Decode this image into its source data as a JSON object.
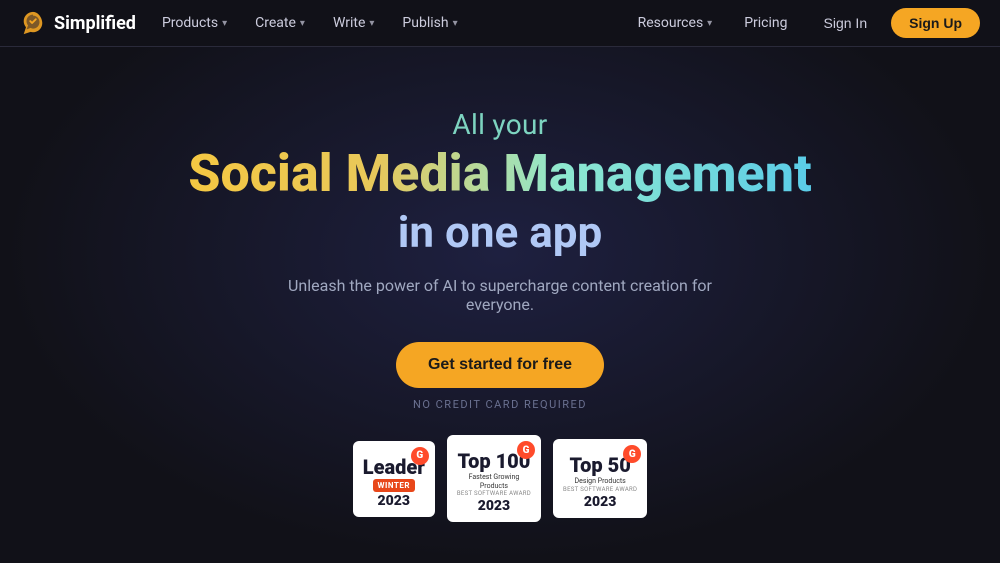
{
  "navbar": {
    "logo_text": "Simplified",
    "nav_items": [
      {
        "label": "Products",
        "has_dropdown": true
      },
      {
        "label": "Create",
        "has_dropdown": true
      },
      {
        "label": "Write",
        "has_dropdown": true
      },
      {
        "label": "Publish",
        "has_dropdown": true
      },
      {
        "label": "Resources",
        "has_dropdown": true
      },
      {
        "label": "Pricing",
        "has_dropdown": false
      }
    ],
    "sign_in_label": "Sign In",
    "sign_up_label": "Sign Up"
  },
  "hero": {
    "subtitle": "All your",
    "title_main": "Social Media Management",
    "title_bottom": "in one app",
    "description": "Unleash the power of AI to supercharge content creation for everyone.",
    "cta_button": "Get started for free",
    "no_credit_text": "NO CREDIT CARD REQUIRED"
  },
  "badges": [
    {
      "rank": "Leader",
      "type_label": "WINTER",
      "year": "2023",
      "g_label": "G",
      "desc": ""
    },
    {
      "rank": "Top 100",
      "type_label": "Fastest Growing Products",
      "year": "2023",
      "g_label": "G",
      "desc": "BEST SOFTWARE AWARD"
    },
    {
      "rank": "Top 50",
      "type_label": "Design Products",
      "year": "2023",
      "g_label": "G",
      "desc": "BEST SOFTWARE AWARD"
    }
  ],
  "colors": {
    "brand_orange": "#f5a623",
    "background": "#111118",
    "text_primary": "#ffffff",
    "text_secondary": "#a0a8c0",
    "accent_teal": "#7dd4c0",
    "title_gradient_start": "#f5c842",
    "title_gradient_end": "#5acce8"
  }
}
